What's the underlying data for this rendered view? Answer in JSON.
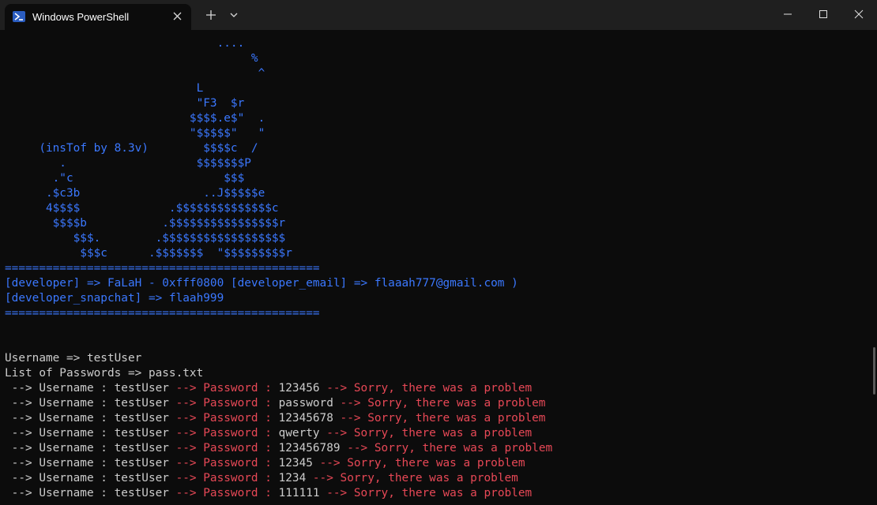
{
  "tab": {
    "title": "Windows PowerShell",
    "icon": "powershell-icon"
  },
  "colors": {
    "background": "#0c0c0c",
    "titlebar": "#1f1f1f",
    "blue": "#3b78ff",
    "red": "#e74856",
    "gray": "#cccccc"
  },
  "banner": [
    "                               ....",
    "                                    %",
    "                                     ^",
    "                            L",
    "                            \"F3  $r",
    "                           $$$$.e$\"  .",
    "                           \"$$$$$\"   \"",
    "     (insTof by 8.3v)        $$$$c  /",
    "        .                   $$$$$$$P",
    "       .\"c                      $$$",
    "      .$c3b                  ..J$$$$$e",
    "      4$$$$             .$$$$$$$$$$$$$$c",
    "       $$$$b           .$$$$$$$$$$$$$$$$r",
    "          $$$.        .$$$$$$$$$$$$$$$$$$",
    "           $$$c      .$$$$$$$  \"$$$$$$$$$r"
  ],
  "separator": "==============================================",
  "developer_line": "[developer] => FaLaH - 0xfff0800 [developer_email] => flaaah777@gmail.com )",
  "snapchat_line": "[developer_snapchat] => flaah999",
  "username_line": "Username => testUser",
  "passwords_line": "List of Passwords => pass.txt",
  "attempts": [
    {
      "prefix": " --> Username : testUser ",
      "label": "--> Password : ",
      "password": "123456",
      "result": " --> Sorry, there was a problem"
    },
    {
      "prefix": " --> Username : testUser ",
      "label": "--> Password : ",
      "password": "password",
      "result": " --> Sorry, there was a problem"
    },
    {
      "prefix": " --> Username : testUser ",
      "label": "--> Password : ",
      "password": "12345678",
      "result": " --> Sorry, there was a problem"
    },
    {
      "prefix": " --> Username : testUser ",
      "label": "--> Password : ",
      "password": "qwerty",
      "result": " --> Sorry, there was a problem"
    },
    {
      "prefix": " --> Username : testUser ",
      "label": "--> Password : ",
      "password": "123456789",
      "result": " --> Sorry, there was a problem"
    },
    {
      "prefix": " --> Username : testUser ",
      "label": "--> Password : ",
      "password": "12345",
      "result": " --> Sorry, there was a problem"
    },
    {
      "prefix": " --> Username : testUser ",
      "label": "--> Password : ",
      "password": "1234",
      "result": " --> Sorry, there was a problem"
    },
    {
      "prefix": " --> Username : testUser ",
      "label": "--> Password : ",
      "password": "111111",
      "result": " --> Sorry, there was a problem"
    }
  ]
}
